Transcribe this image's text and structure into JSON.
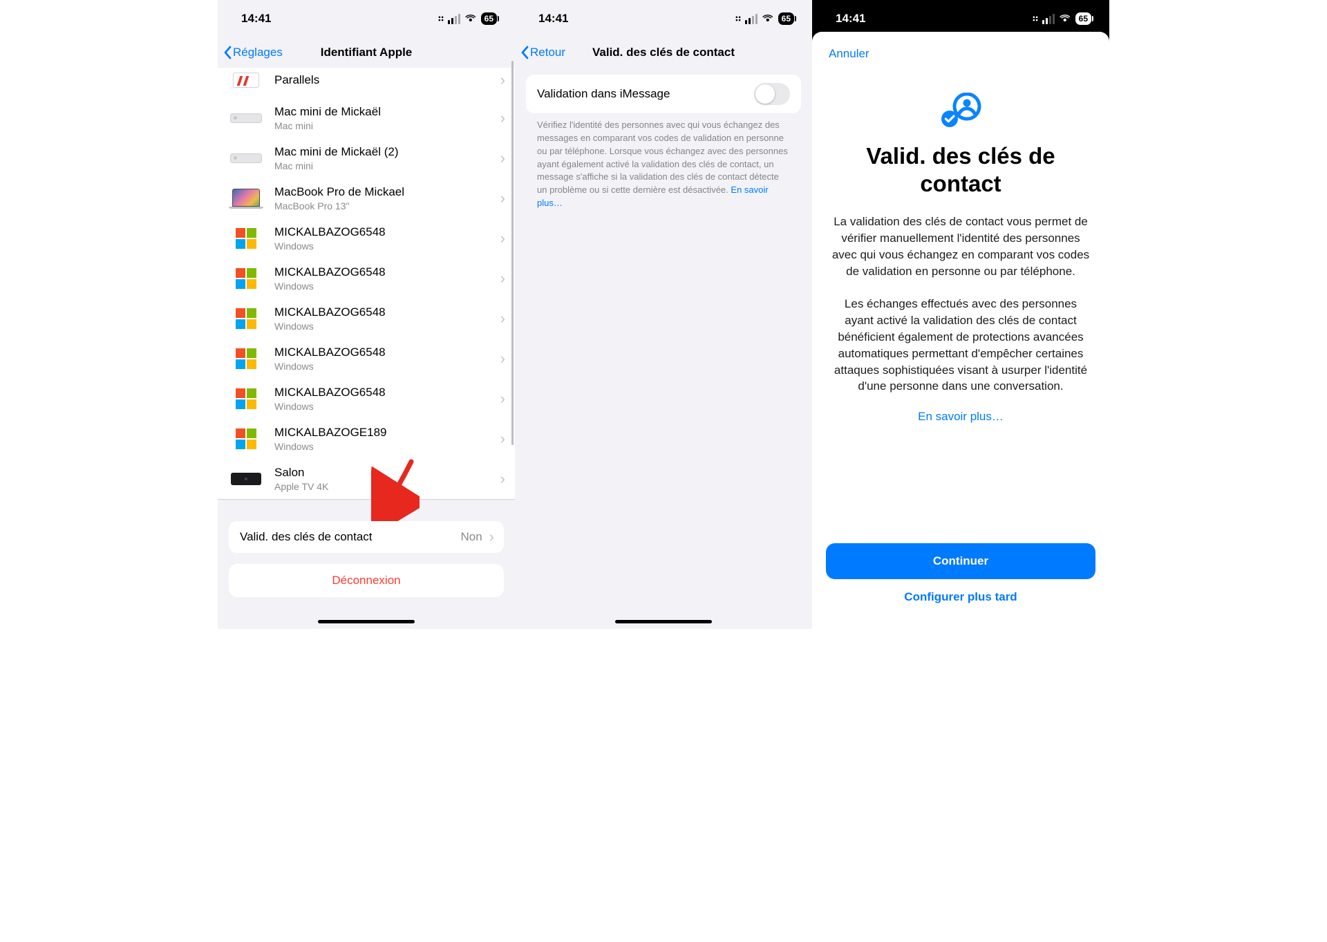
{
  "status": {
    "time": "14:41",
    "battery": "65"
  },
  "p1": {
    "back": "Réglages",
    "title": "Identifiant Apple",
    "devices": [
      {
        "kind": "parallels",
        "name": "Parallels",
        "sub": ""
      },
      {
        "kind": "mini",
        "name": "Mac mini de Mickaël",
        "sub": "Mac mini"
      },
      {
        "kind": "mini",
        "name": "Mac mini de Mickaël (2)",
        "sub": "Mac mini"
      },
      {
        "kind": "mbp",
        "name": "MacBook Pro de Mickael",
        "sub": "MacBook Pro 13\""
      },
      {
        "kind": "win",
        "name": "MICKALBAZOG6548",
        "sub": "Windows"
      },
      {
        "kind": "win",
        "name": "MICKALBAZOG6548",
        "sub": "Windows"
      },
      {
        "kind": "win",
        "name": "MICKALBAZOG6548",
        "sub": "Windows"
      },
      {
        "kind": "win",
        "name": "MICKALBAZOG6548",
        "sub": "Windows"
      },
      {
        "kind": "win",
        "name": "MICKALBAZOG6548",
        "sub": "Windows"
      },
      {
        "kind": "win",
        "name": "MICKALBAZOGE189",
        "sub": "Windows"
      },
      {
        "kind": "atv",
        "name": "Salon",
        "sub": "Apple TV 4K"
      }
    ],
    "ckv_label": "Valid. des clés de contact",
    "ckv_value": "Non",
    "signout": "Déconnexion"
  },
  "p2": {
    "back": "Retour",
    "title": "Valid. des clés de contact",
    "toggle_label": "Validation dans iMessage",
    "footer": "Vérifiez l'identité des personnes avec qui vous échangez des messages en comparant vos codes de validation en personne ou par téléphone. Lorsque vous échangez avec des personnes ayant également activé la validation des clés de contact, un message s'affiche si la validation des clés de contact détecte un problème ou si cette dernière est désactivée.",
    "learn_more": "En savoir plus…"
  },
  "p3": {
    "cancel": "Annuler",
    "title": "Valid. des clés de contact",
    "para1": "La validation des clés de contact vous permet de vérifier manuellement l'identité des personnes avec qui vous échangez en comparant vos codes de validation en personne ou par téléphone.",
    "para2": "Les échanges effectués avec des personnes ayant activé la validation des clés de contact bénéficient également de protections avancées automatiques permettant d'empêcher certaines attaques sophistiquées visant à usurper l'identité d'une personne dans une conversation.",
    "learn_more": "En savoir plus…",
    "continue": "Continuer",
    "later": "Configurer plus tard"
  }
}
